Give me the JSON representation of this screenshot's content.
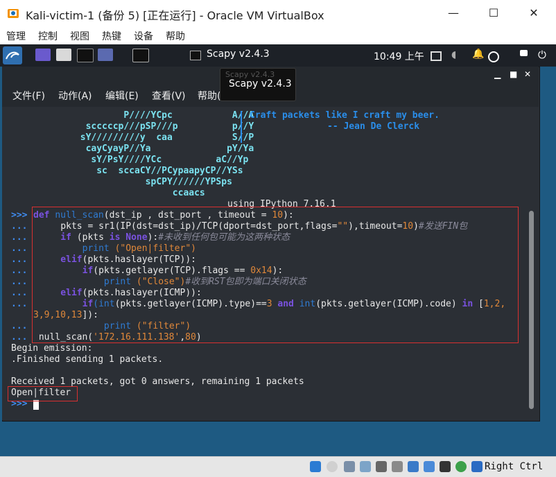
{
  "window": {
    "title": "Kali-victim-1 (备份 5) [正在运行] - Oracle VM VirtualBox",
    "min_glyph": "—",
    "max_glyph": "☐",
    "close_glyph": "✕"
  },
  "vbox_menu": [
    "管理",
    "控制",
    "视图",
    "热键",
    "设备",
    "帮助"
  ],
  "kali_panel": {
    "task_label": "Scapy v2.4.3",
    "clock": "10:49 上午"
  },
  "terminal": {
    "tooltip": "Scapy v2.4.3",
    "tooltip_ghost": "Scapy v2.4.3",
    "menu": [
      "文件(F)",
      "动作(A)",
      "编辑(E)",
      "查看(V)",
      "帮助(H)"
    ],
    "ascii_art": [
      "                     P////YCpc           A//A ",
      "              scccccp///pSP///p          p//Y ",
      "             sY/////////y  caa           S//P ",
      "              cayCyayP//Ya              pY/Ya ",
      "               sY/PsY////YCc          aC//Yp  ",
      "                sc  sccaCY//PCypaapyCP//YSs   ",
      "                         spCPY//////YPSps     ",
      "                              ccaacs          "
    ],
    "quote_line1": "Craft packets like I craft my beer.",
    "quote_line2": "-- Jean De Clerck",
    "using_line": "using IPython 7.16.1",
    "prompt": ">>>",
    "cont": "...",
    "code": {
      "l1_def": "def",
      "l1_name": "null_scan",
      "l1_rest": "(dst_ip , dst_port , timeout = ",
      "l1_num": "10",
      "l1_end": "):",
      "l2_a": "    pkts = sr1(IP(dst=dst_ip)/TCP(dport=dst_port,flags=",
      "l2_str": "\"\"",
      "l2_b": "),timeout=",
      "l2_num": "10",
      "l2_c": ")",
      "l2_cmt": "#发送FIN包",
      "l3_if": "    if",
      "l3_a": " (pkts ",
      "l3_is": "is",
      "l3_none": " None",
      "l3_b": "):",
      "l3_cmt": "#未收到任何包可能为这两种状态",
      "l4_print": "        print",
      "l4_str": " (\"Open|filter\")",
      "l5_elif": "    elif",
      "l5_a": "(pkts.haslayer(TCP)):",
      "l6_if": "        if",
      "l6_a": "(pkts.getlayer(TCP).flags ",
      "l6_eq": "==",
      "l6_num": " 0x14",
      "l6_b": "):",
      "l7_print": "            print",
      "l7_str": " (\"Close\")",
      "l7_cmt": "#收到RST包即为端口关闭状态",
      "l8_elif": "    elif",
      "l8_a": "(pkts.haslayer(ICMP)):",
      "l9_if": "        if",
      "l9_int1": "(int",
      "l9_a": "(pkts.getlayer(ICMP).type)",
      "l9_eq": "==",
      "l9_num": "3",
      "l9_and": " and ",
      "l9_int2": "int",
      "l9_b": "(pkts.getlayer(ICMP).code) ",
      "l9_in": "in",
      "l9_c": " [",
      "l9_n": "1,2,",
      "l10_n": "3,9,10,13",
      "l10_end": "]):",
      "l11_print": "            print",
      "l11_str": " (\"filter\")",
      "l12_a": " null_scan(",
      "l12_str": "'172.16.111.138'",
      "l12_b": ",",
      "l12_num": "80",
      "l12_c": ")"
    },
    "output": [
      "Begin emission:",
      ".Finished sending 1 packets.",
      "",
      "Received 1 packets, got 0 answers, remaining 1 packets",
      "Open|filter"
    ]
  },
  "statusbar": {
    "hostkey": "Right Ctrl"
  },
  "colors": {
    "highlight_box": "#d93030",
    "terminal_bg": "#2b2f35",
    "desktop_bg": "#1e5a82"
  }
}
